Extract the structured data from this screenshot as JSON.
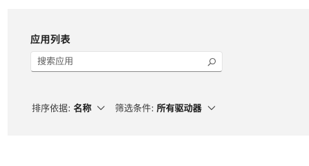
{
  "apps_section": {
    "title": "应用列表",
    "search": {
      "placeholder": "搜索应用",
      "value": "",
      "icon": "search-icon"
    },
    "sort": {
      "label": "排序依据:",
      "value": "名称",
      "icon": "chevron-down-icon"
    },
    "filter": {
      "label": "筛选条件:",
      "value": "所有驱动器",
      "icon": "chevron-down-icon"
    }
  },
  "colors": {
    "panel_background": "#f3f3f3",
    "input_background": "#ffffff",
    "text_primary": "#1b1b1b"
  }
}
